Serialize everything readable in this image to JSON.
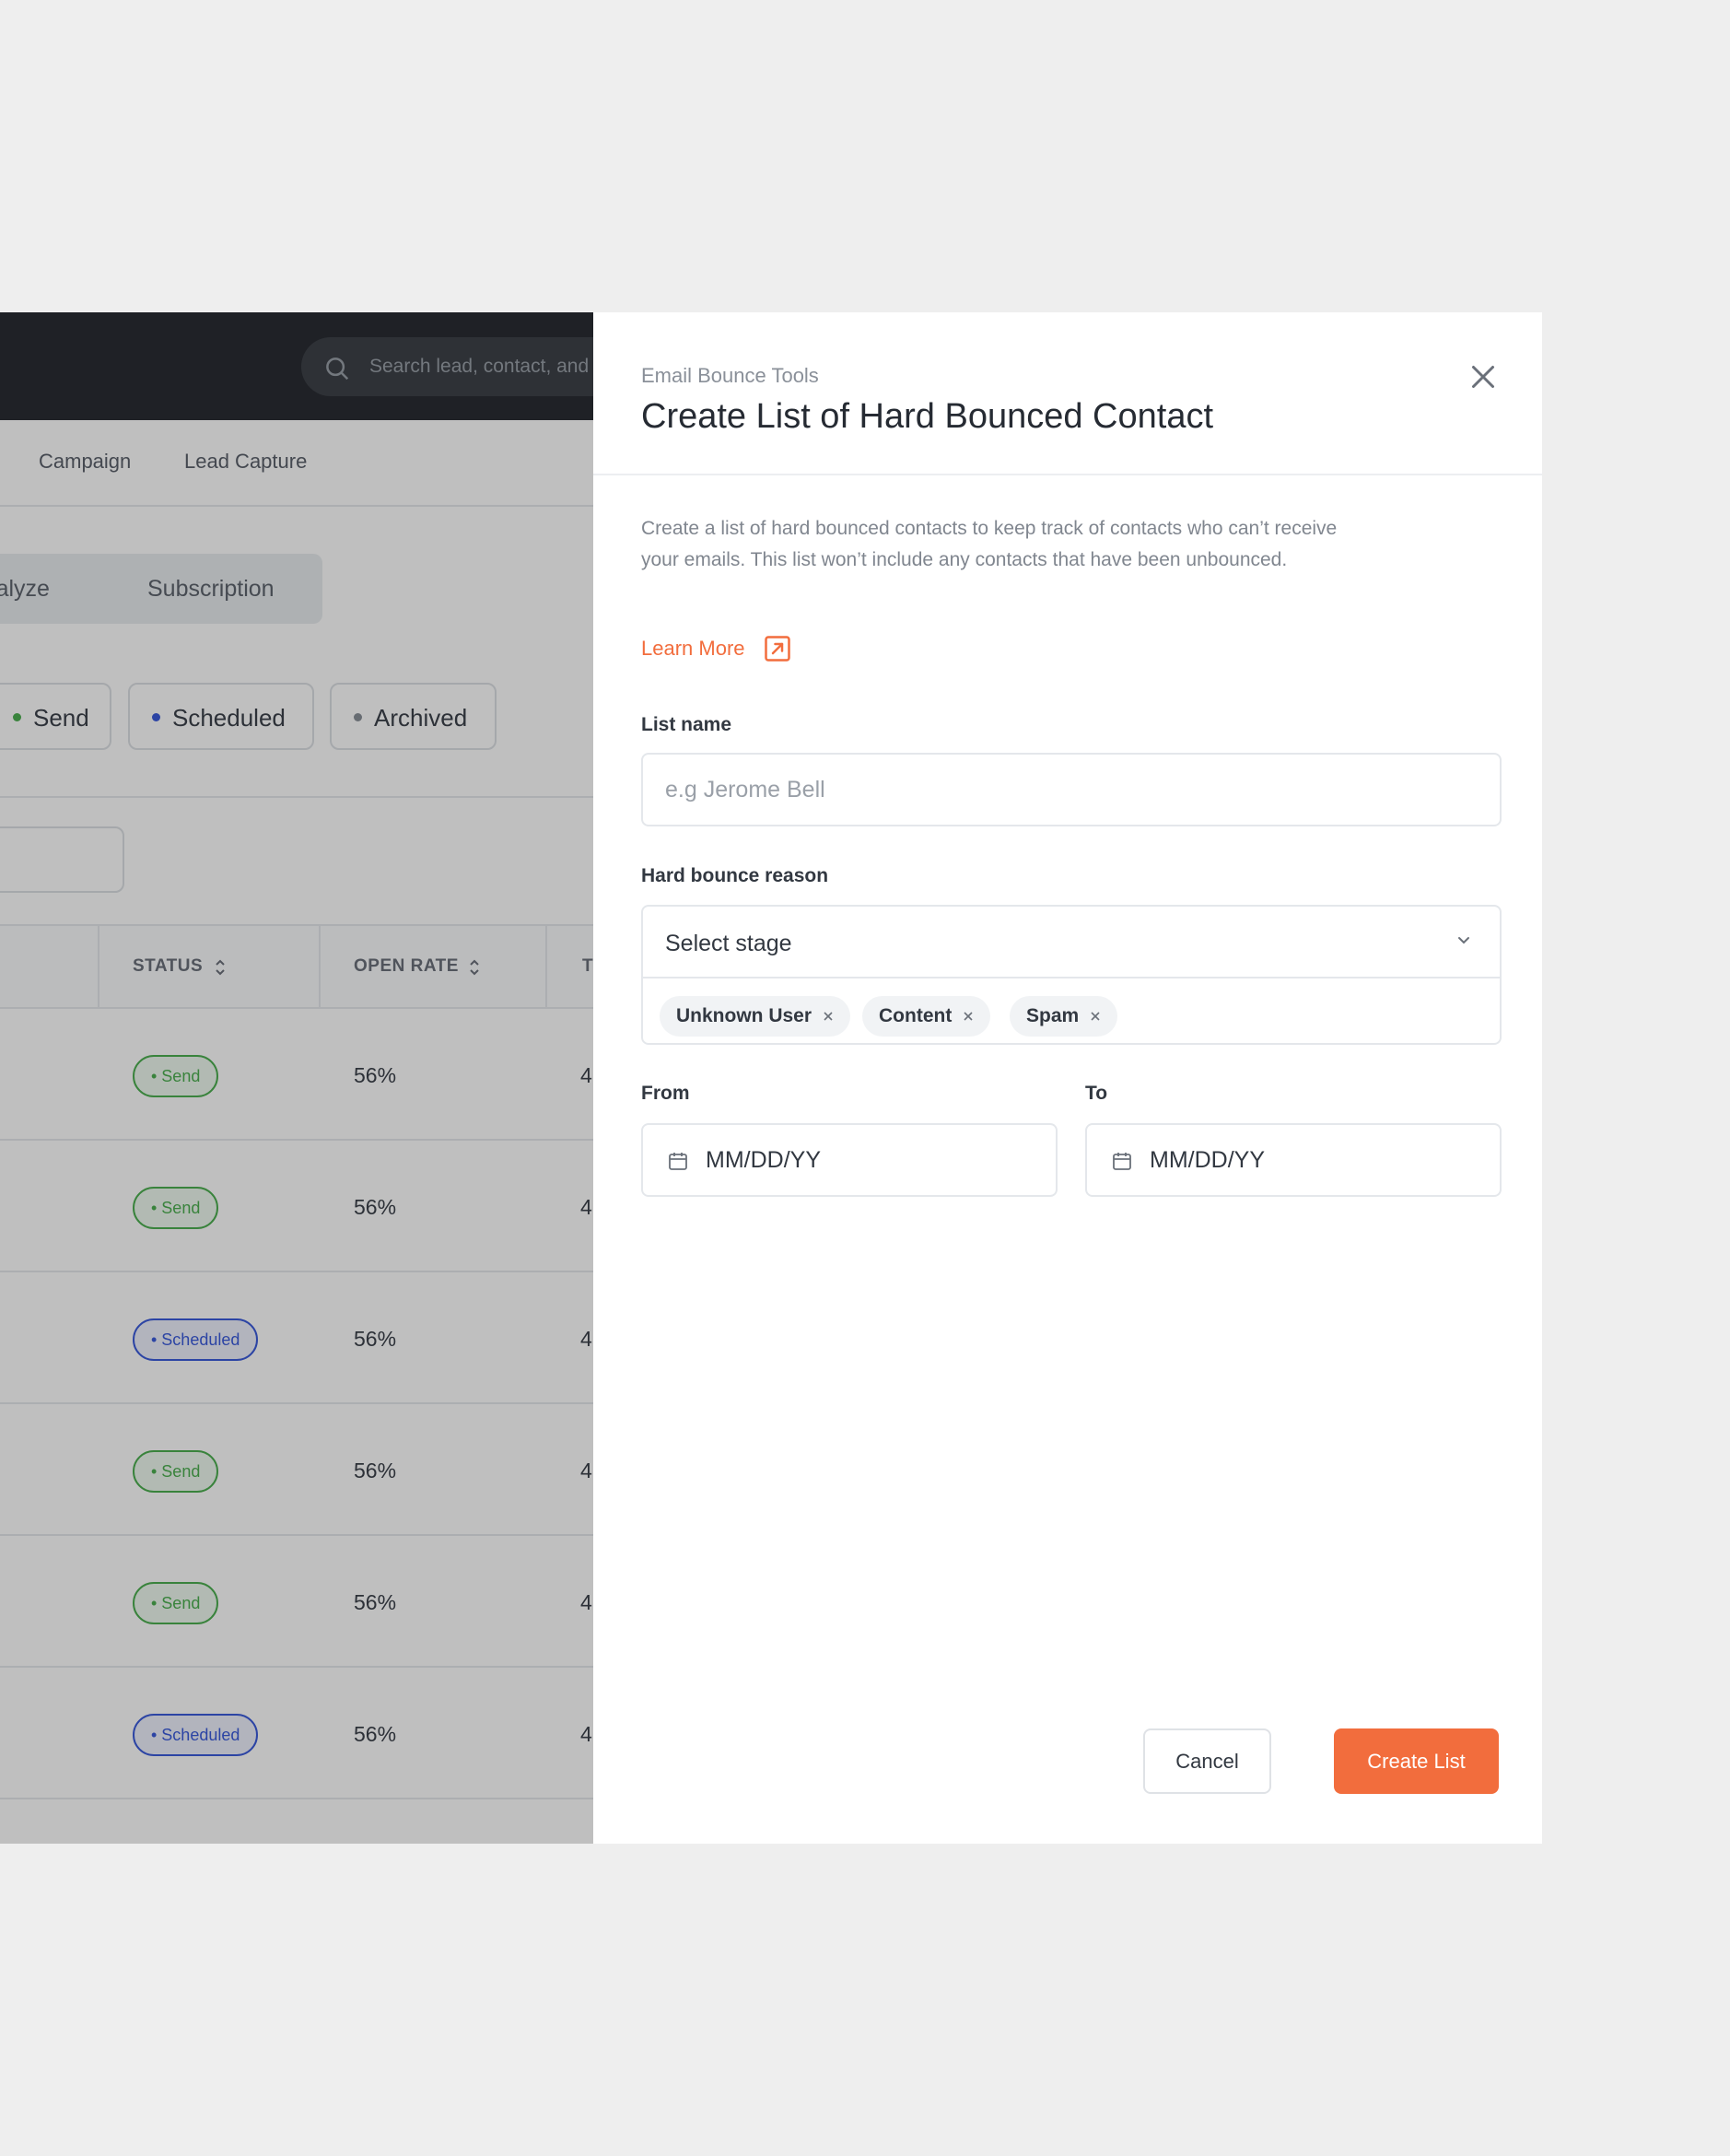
{
  "app": {
    "search_placeholder": "Search lead, contact, and more",
    "nav_tabs": [
      "Campaign",
      "Lead Capture"
    ],
    "sub_tabs": [
      "Analyze",
      "Subscription"
    ],
    "filters": [
      {
        "label": "Send",
        "color": "#4caf50"
      },
      {
        "label": "Scheduled",
        "color": "#3b5bdb"
      },
      {
        "label": "Archived",
        "color": "#8a9099"
      }
    ],
    "table": {
      "columns": [
        "STATUS",
        "OPEN RATE",
        "T"
      ],
      "rows": [
        {
          "status": "• Send",
          "open_rate": "56%",
          "extra": "4"
        },
        {
          "status": "• Send",
          "open_rate": "56%",
          "extra": "4"
        },
        {
          "status": "• Scheduled",
          "open_rate": "56%",
          "extra": "4"
        },
        {
          "status": "• Send",
          "open_rate": "56%",
          "extra": "4"
        },
        {
          "status": "• Send",
          "open_rate": "56%",
          "extra": "4"
        },
        {
          "status": "• Scheduled",
          "open_rate": "56%",
          "extra": "4"
        }
      ]
    }
  },
  "modal": {
    "subtitle": "Email Bounce Tools",
    "title": "Create List of Hard Bounced Contact",
    "description": "Create a list of hard bounced contacts to keep track of contacts who can’t receive your emails. This list won’t include any contacts that have been unbounced.",
    "learn_more": "Learn More",
    "list_name": {
      "label": "List name",
      "placeholder": "e.g Jerome Bell"
    },
    "bounce_reason": {
      "label": "Hard bounce reason",
      "select_value": "Select stage",
      "chips": [
        "Unknown User",
        "Content",
        "Spam"
      ]
    },
    "from": {
      "label": "From",
      "value": "MM/DD/YY"
    },
    "to": {
      "label": "To",
      "value": "MM/DD/YY"
    },
    "cancel_label": "Cancel",
    "create_label": "Create List"
  },
  "colors": {
    "accent": "#f26d3d",
    "send": "#4caf50",
    "scheduled": "#3b5bdb",
    "topbar": "#2a2d33"
  }
}
